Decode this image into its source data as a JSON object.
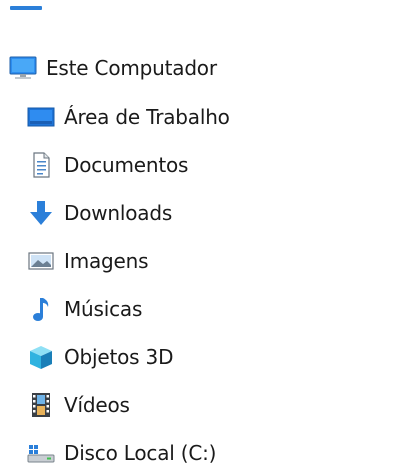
{
  "navigation_pane": {
    "root": {
      "label": "Este Computador",
      "icon": "monitor-icon"
    },
    "items": [
      {
        "label": "Área de Trabalho",
        "icon": "desktop-icon"
      },
      {
        "label": "Documentos",
        "icon": "documents-icon"
      },
      {
        "label": "Downloads",
        "icon": "download-arrow-icon"
      },
      {
        "label": "Imagens",
        "icon": "pictures-icon"
      },
      {
        "label": "Músicas",
        "icon": "music-note-icon"
      },
      {
        "label": "Objetos 3D",
        "icon": "cube-3d-icon"
      },
      {
        "label": "Vídeos",
        "icon": "film-icon"
      },
      {
        "label": "Disco Local (C:)",
        "icon": "drive-icon"
      }
    ]
  },
  "colors": {
    "accent_blue": "#2b7fd9",
    "text": "#1a1a1a",
    "background": "#ffffff"
  }
}
